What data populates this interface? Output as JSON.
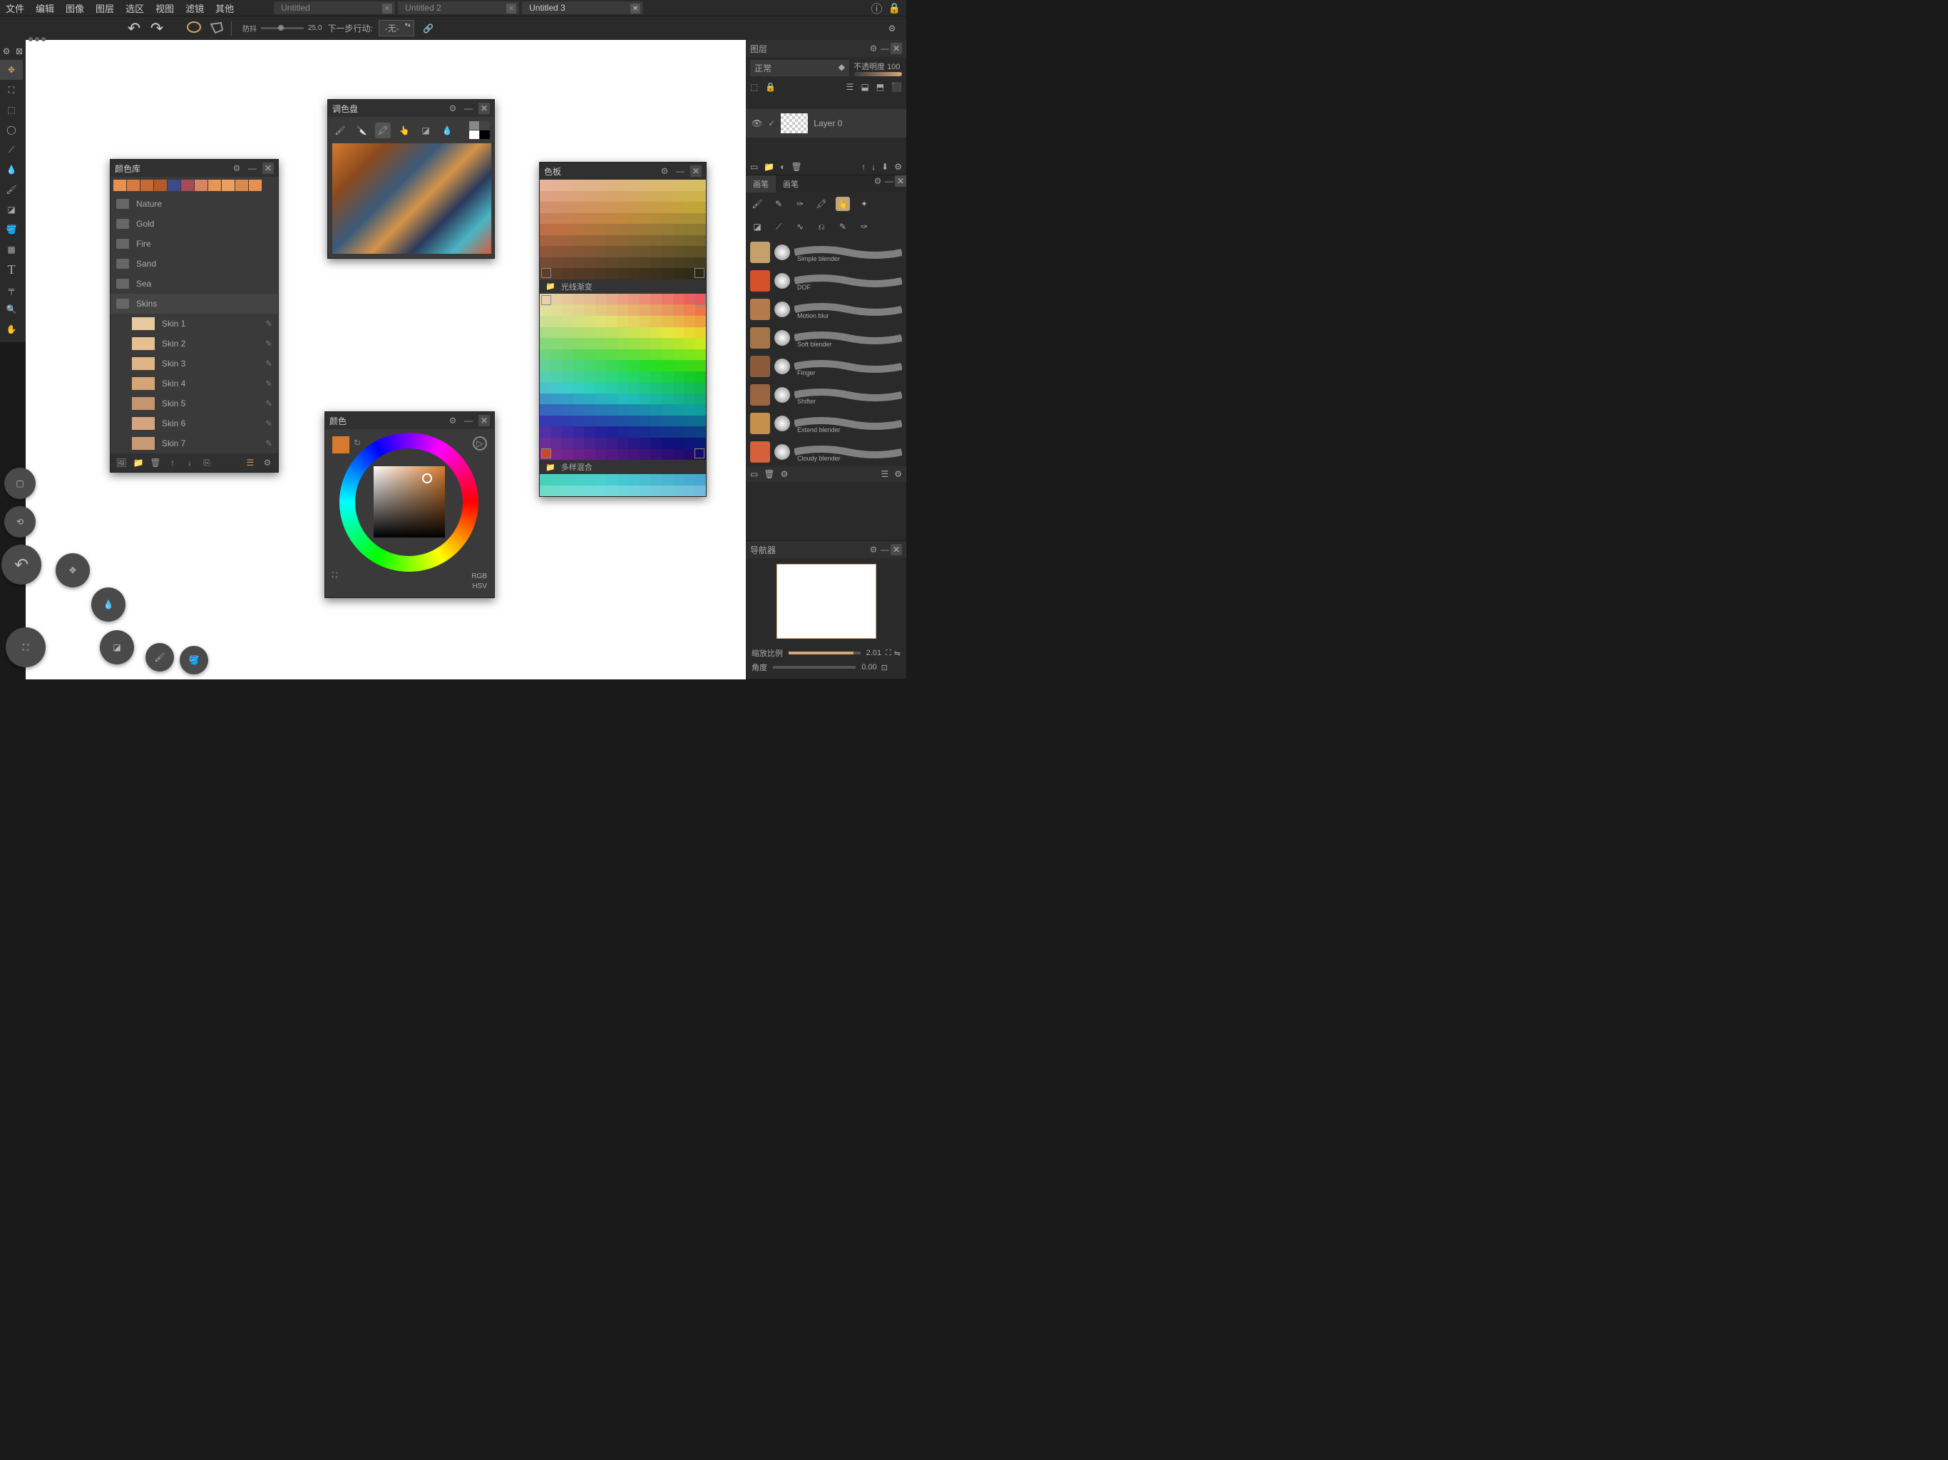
{
  "menu": [
    "文件",
    "编辑",
    "图像",
    "图层",
    "选区",
    "视图",
    "滤镜",
    "其他"
  ],
  "tabs": [
    {
      "name": "Untitled",
      "active": false
    },
    {
      "name": "Untitled 2",
      "active": false
    },
    {
      "name": "Untitled 3",
      "active": true
    }
  ],
  "toolbar": {
    "stabilizer_label": "防抖",
    "stabilizer_value": "25.0",
    "next_action_label": "下一步行动:",
    "next_action_value": "-无-"
  },
  "colorlib": {
    "title": "颜色库",
    "swatches": [
      "#e89050",
      "#d67b40",
      "#c56a35",
      "#b55a2a",
      "#3a4a8a",
      "#a54a5a",
      "#d68560",
      "#e59555",
      "#e8a060",
      "#d68a50",
      "#e89050"
    ],
    "folders": [
      "Nature",
      "Gold",
      "Fire",
      "Sand",
      "Sea",
      "Skins"
    ],
    "skins": [
      {
        "name": "Skin 1",
        "color": "#e8c9a0"
      },
      {
        "name": "Skin 2",
        "color": "#e5c090"
      },
      {
        "name": "Skin 3",
        "color": "#e0b585"
      },
      {
        "name": "Skin 4",
        "color": "#d5a578"
      },
      {
        "name": "Skin 5",
        "color": "#c59570"
      },
      {
        "name": "Skin 6",
        "color": "#d5a580"
      },
      {
        "name": "Skin 7",
        "color": "#c89a75"
      }
    ]
  },
  "palette": {
    "title": "调色盘"
  },
  "color": {
    "title": "颜色",
    "mode1": "RGB",
    "mode2": "HSV"
  },
  "swatches_panel": {
    "title": "色板",
    "section1": "光线渐变",
    "section2": "多样混合"
  },
  "layers": {
    "title": "图层",
    "blend_mode": "正常",
    "opacity_label": "不透明度",
    "opacity_value": "100",
    "layer_name": "Layer 0"
  },
  "brushes": {
    "tab1": "画笔",
    "tab2": "画笔",
    "items": [
      {
        "name": "Simple blender",
        "handle": "#c5a068"
      },
      {
        "name": "DOF",
        "handle": "#d6502a"
      },
      {
        "name": "Motion blur",
        "handle": "#b57a4a"
      },
      {
        "name": "Soft blender",
        "handle": "#a5754a"
      },
      {
        "name": "Finger",
        "handle": "#8a5a3a"
      },
      {
        "name": "Shifter",
        "handle": "#9a6540"
      },
      {
        "name": "Extend blender",
        "handle": "#c5904a"
      },
      {
        "name": "Cloudy blender",
        "handle": "#d6603a"
      }
    ]
  },
  "navigator": {
    "title": "导航器",
    "zoom_label": "缩放比例",
    "zoom_value": "2.01",
    "angle_label": "角度",
    "angle_value": "0.00"
  }
}
